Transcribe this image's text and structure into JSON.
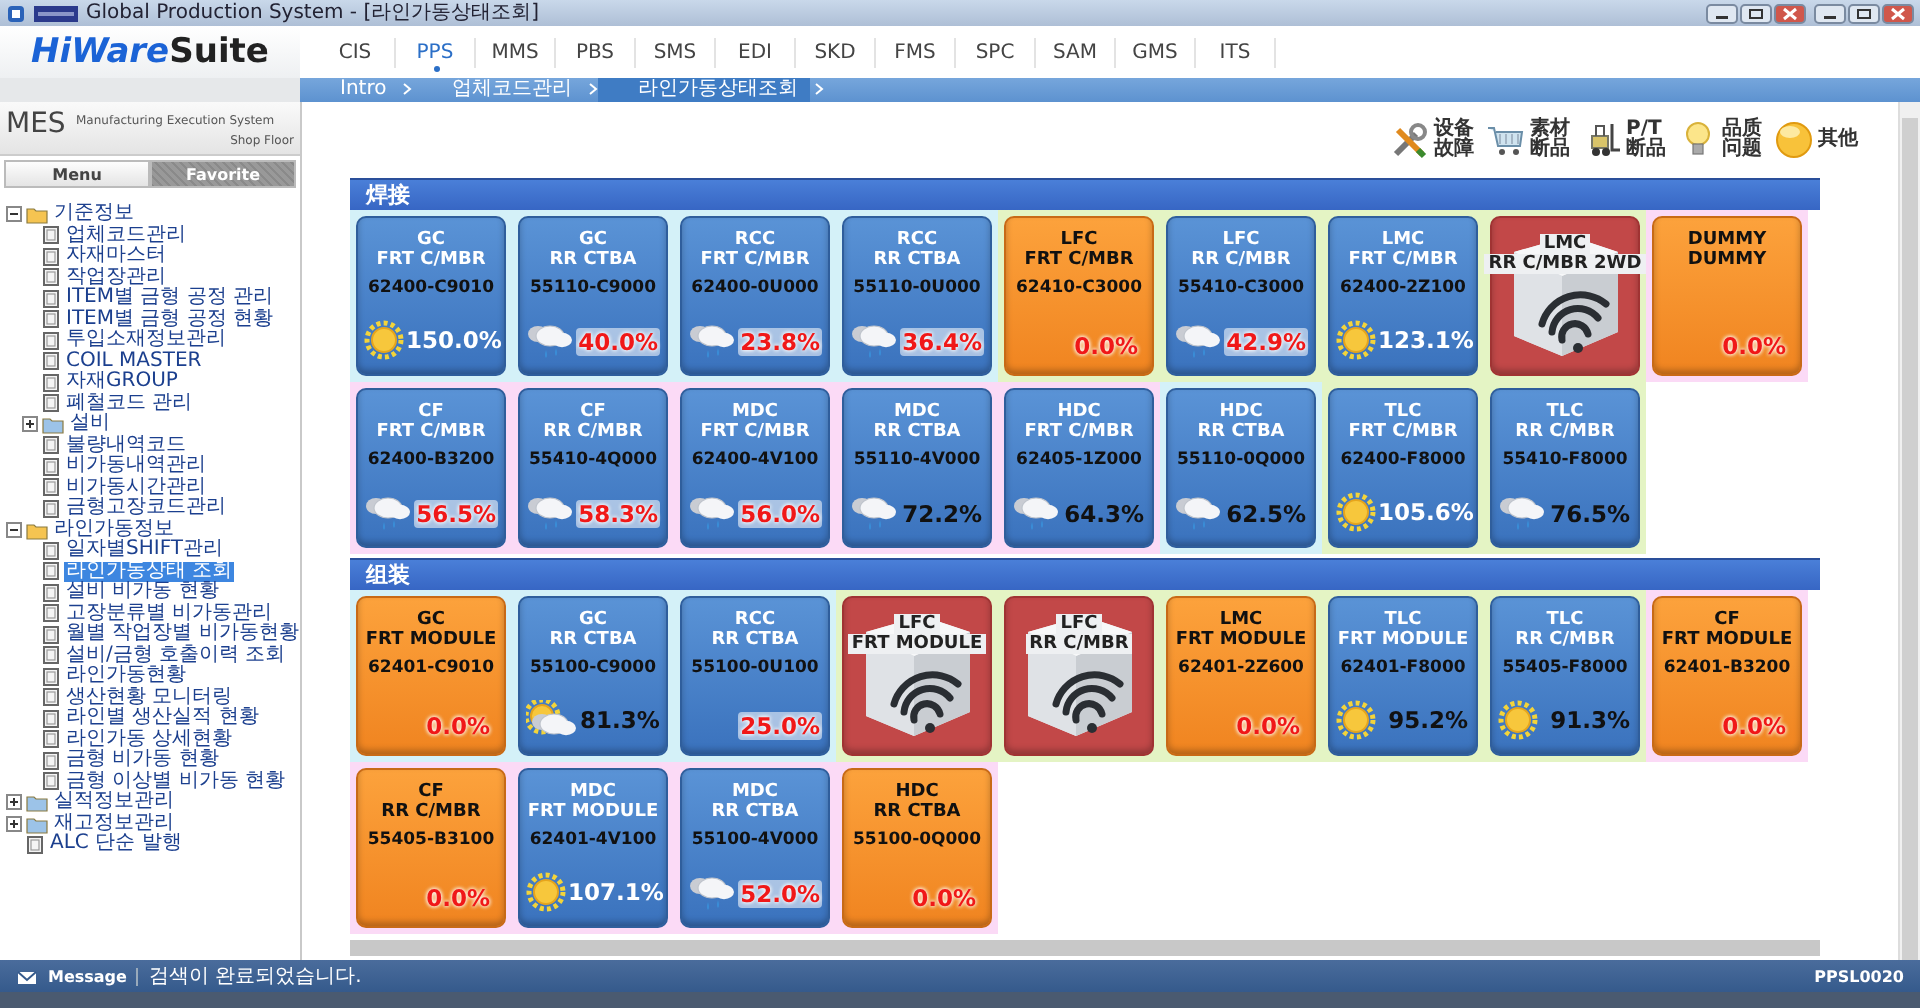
{
  "window": {
    "title": "Global Production System - [라인가동상태조회]"
  },
  "header": {
    "logo": {
      "first": "HiWare",
      "second": "Suite"
    },
    "nav": [
      {
        "label": "CIS",
        "selected": false
      },
      {
        "label": "PPS",
        "selected": true
      },
      {
        "label": "MMS",
        "selected": false
      },
      {
        "label": "PBS",
        "selected": false
      },
      {
        "label": "SMS",
        "selected": false
      },
      {
        "label": "EDI",
        "selected": false
      },
      {
        "label": "SKD",
        "selected": false
      },
      {
        "label": "FMS",
        "selected": false
      },
      {
        "label": "SPC",
        "selected": false
      },
      {
        "label": "SAM",
        "selected": false
      },
      {
        "label": "GMS",
        "selected": false
      },
      {
        "label": "ITS",
        "selected": false
      }
    ]
  },
  "breadcrumb": [
    "Intro",
    "업체코드관리",
    "라인가동상태조회"
  ],
  "sidebar": {
    "title": "MES",
    "subtitle": "Manufacturing Execution System",
    "caption": "Shop Floor",
    "tabs": [
      {
        "label": "Menu",
        "selected": true
      },
      {
        "label": "Favorite",
        "selected": false
      }
    ],
    "tree": [
      {
        "kind": "folder",
        "label": "기준정보",
        "expanded": true,
        "children": [
          {
            "kind": "page",
            "label": "업체코드관리",
            "selected": false
          },
          {
            "kind": "page",
            "label": "자재마스터",
            "selected": false
          },
          {
            "kind": "page",
            "label": "작업장관리",
            "selected": false
          },
          {
            "kind": "page",
            "label": "ITEM별 금형 공정 관리",
            "selected": false
          },
          {
            "kind": "page",
            "label": "ITEM별 금형 공정 현황",
            "selected": false
          },
          {
            "kind": "page",
            "label": "투입소재정보관리",
            "selected": false
          },
          {
            "kind": "page",
            "label": "COIL MASTER",
            "selected": false
          },
          {
            "kind": "page",
            "label": "자재GROUP",
            "selected": false
          },
          {
            "kind": "page",
            "label": "폐철코드 관리",
            "selected": false
          },
          {
            "kind": "folder",
            "label": "설비",
            "expanded": false
          },
          {
            "kind": "page",
            "label": "불량내역코드",
            "selected": false
          },
          {
            "kind": "page",
            "label": "비가동내역관리",
            "selected": false
          },
          {
            "kind": "page",
            "label": "비가동시간관리",
            "selected": false
          },
          {
            "kind": "page",
            "label": "금형고장코드관리",
            "selected": false
          }
        ]
      },
      {
        "kind": "folder",
        "label": "라인가동정보",
        "expanded": true,
        "children": [
          {
            "kind": "page",
            "label": "일자별SHIFT관리",
            "selected": false
          },
          {
            "kind": "page",
            "label": "라인가동상태 조회",
            "selected": true
          },
          {
            "kind": "page",
            "label": "설비 비가동 현황",
            "selected": false
          },
          {
            "kind": "page",
            "label": "고장분류별 비가동관리",
            "selected": false
          },
          {
            "kind": "page",
            "label": "월별 작업장별 비가동현황",
            "selected": false
          },
          {
            "kind": "page",
            "label": "설비/금형 호출이력 조회",
            "selected": false
          },
          {
            "kind": "page",
            "label": "라인가동현황",
            "selected": false
          },
          {
            "kind": "page",
            "label": "생산현황 모니터링",
            "selected": false
          },
          {
            "kind": "page",
            "label": "라인별 생산실적 현황",
            "selected": false
          },
          {
            "kind": "page",
            "label": "라인가동 상세현황",
            "selected": false
          },
          {
            "kind": "page",
            "label": "금형 비가동 현황",
            "selected": false
          },
          {
            "kind": "page",
            "label": "금형 이상별 비가동 현황",
            "selected": false
          }
        ]
      },
      {
        "kind": "folder",
        "label": "실적정보관리",
        "expanded": false
      },
      {
        "kind": "folder",
        "label": "재고정보관리",
        "expanded": false
      },
      {
        "kind": "page",
        "label": "ALC 단순 발행",
        "selected": false
      }
    ]
  },
  "legend": [
    {
      "kind": "tools",
      "label": "设备故障"
    },
    {
      "kind": "cart",
      "label": "素材断品"
    },
    {
      "kind": "forklift",
      "label": "P/T断品"
    },
    {
      "kind": "bulb",
      "label": "品质问题"
    },
    {
      "kind": "ball",
      "label": "其他"
    }
  ],
  "sections": [
    {
      "title": "焊接",
      "rows": [
        {
          "groups": [
            {
              "color": "#d4f1f8",
              "cards": [
                {
                  "kind": "running",
                  "line": "GC",
                  "part": "FRT C/MBR",
                  "code": "62400-C9010",
                  "weather": {
                    "kind": "sunny"
                  },
                  "rate": "150.0%",
                  "below_target": false,
                  "above_target": true
                },
                {
                  "kind": "running",
                  "line": "GC",
                  "part": "RR CTBA",
                  "code": "55110-C9000",
                  "weather": {
                    "kind": "rainy"
                  },
                  "rate": "40.0%",
                  "below_target": true,
                  "above_target": false
                },
                {
                  "kind": "running",
                  "line": "RCC",
                  "part": "FRT C/MBR",
                  "code": "62400-0U000",
                  "weather": {
                    "kind": "rainy"
                  },
                  "rate": "23.8%",
                  "below_target": true,
                  "above_target": false
                },
                {
                  "kind": "running",
                  "line": "RCC",
                  "part": "RR CTBA",
                  "code": "55110-0U000",
                  "weather": {
                    "kind": "rainy"
                  },
                  "rate": "36.4%",
                  "below_target": true,
                  "above_target": false
                }
              ]
            },
            {
              "color": "#e4f4c4",
              "cards": [
                {
                  "kind": "stopped",
                  "line": "LFC",
                  "part": "FRT C/MBR",
                  "code": "62410-C3000",
                  "rate": "0.0%"
                },
                {
                  "kind": "running",
                  "line": "LFC",
                  "part": "RR C/MBR",
                  "code": "55410-C3000",
                  "weather": {
                    "kind": "rainy"
                  },
                  "rate": "42.9%",
                  "below_target": true,
                  "above_target": false
                },
                {
                  "kind": "running",
                  "line": "LMC",
                  "part": "FRT C/MBR",
                  "code": "62400-2Z100",
                  "weather": {
                    "kind": "sunny"
                  },
                  "rate": "123.1%",
                  "below_target": false,
                  "above_target": true
                },
                {
                  "kind": "offline",
                  "line": "LMC",
                  "part": "RR C/MBR 2WD"
                }
              ]
            },
            {
              "color": "#fbdaf6",
              "cards": [
                {
                  "kind": "stopped",
                  "line": "DUMMY",
                  "part": "DUMMY",
                  "rate": "0.0%"
                }
              ]
            }
          ]
        },
        {
          "groups": [
            {
              "color": "#fbdaf6",
              "cards": [
                {
                  "kind": "running",
                  "line": "CF",
                  "part": "FRT C/MBR",
                  "code": "62400-B3200",
                  "weather": {
                    "kind": "rainy"
                  },
                  "rate": "56.5%",
                  "below_target": true,
                  "above_target": false
                },
                {
                  "kind": "running",
                  "line": "CF",
                  "part": "RR C/MBR",
                  "code": "55410-4Q000",
                  "weather": {
                    "kind": "rainy"
                  },
                  "rate": "58.3%",
                  "below_target": true,
                  "above_target": false
                },
                {
                  "kind": "running",
                  "line": "MDC",
                  "part": "FRT C/MBR",
                  "code": "62400-4V100",
                  "weather": {
                    "kind": "rainy"
                  },
                  "rate": "56.0%",
                  "below_target": true,
                  "above_target": false
                },
                {
                  "kind": "running",
                  "line": "MDC",
                  "part": "RR CTBA",
                  "code": "55110-4V000",
                  "weather": {
                    "kind": "rainy"
                  },
                  "rate": "72.2%",
                  "below_target": false,
                  "above_target": false
                },
                {
                  "kind": "running",
                  "line": "HDC",
                  "part": "FRT C/MBR",
                  "code": "62405-1Z000",
                  "weather": {
                    "kind": "rainy"
                  },
                  "rate": "64.3%",
                  "below_target": false,
                  "above_target": false
                }
              ]
            },
            {
              "color": "#d4f1f8",
              "cards": [
                {
                  "kind": "running",
                  "line": "HDC",
                  "part": "RR CTBA",
                  "code": "55110-0Q000",
                  "weather": {
                    "kind": "rainy"
                  },
                  "rate": "62.5%",
                  "below_target": false,
                  "above_target": false
                }
              ]
            },
            {
              "color": "#e4f4c4",
              "cards": [
                {
                  "kind": "running",
                  "line": "TLC",
                  "part": "FRT C/MBR",
                  "code": "62400-F8000",
                  "weather": {
                    "kind": "sunny"
                  },
                  "rate": "105.6%",
                  "below_target": false,
                  "above_target": true
                },
                {
                  "kind": "running",
                  "line": "TLC",
                  "part": "RR C/MBR",
                  "code": "55410-F8000",
                  "weather": {
                    "kind": "rainy"
                  },
                  "rate": "76.5%",
                  "below_target": false,
                  "above_target": false
                }
              ]
            }
          ]
        }
      ]
    },
    {
      "title": "组装",
      "rows": [
        {
          "groups": [
            {
              "color": "#d4f1f8",
              "cards": [
                {
                  "kind": "stopped",
                  "line": "GC",
                  "part": "FRT MODULE",
                  "code": "62401-C9010",
                  "rate": "0.0%"
                },
                {
                  "kind": "running",
                  "line": "GC",
                  "part": "RR CTBA",
                  "code": "55100-C9000",
                  "weather": {
                    "kind": "partly"
                  },
                  "rate": "81.3%",
                  "below_target": false,
                  "above_target": false
                },
                {
                  "kind": "running",
                  "line": "RCC",
                  "part": "RR CTBA",
                  "code": "55100-0U100",
                  "rate": "25.0%",
                  "below_target": true,
                  "above_target": false
                }
              ]
            },
            {
              "color": "#e4f4c4",
              "cards": [
                {
                  "kind": "offline",
                  "line": "LFC",
                  "part": "FRT MODULE"
                },
                {
                  "kind": "offline",
                  "line": "LFC",
                  "part": "RR C/MBR"
                },
                {
                  "kind": "stopped",
                  "line": "LMC",
                  "part": "FRT MODULE",
                  "code": "62401-2Z600",
                  "rate": "0.0%"
                },
                {
                  "kind": "running",
                  "line": "TLC",
                  "part": "FRT MODULE",
                  "code": "62401-F8000",
                  "weather": {
                    "kind": "sunny"
                  },
                  "rate": "95.2%",
                  "below_target": false,
                  "above_target": false
                },
                {
                  "kind": "running",
                  "line": "TLC",
                  "part": "RR C/MBR",
                  "code": "55405-F8000",
                  "weather": {
                    "kind": "sunny"
                  },
                  "rate": "91.3%",
                  "below_target": false,
                  "above_target": false
                }
              ]
            },
            {
              "color": "#fbdaf6",
              "cards": [
                {
                  "kind": "stopped",
                  "line": "CF",
                  "part": "FRT MODULE",
                  "code": "62401-B3200",
                  "rate": "0.0%"
                }
              ]
            }
          ]
        },
        {
          "groups": [
            {
              "color": "#fbdaf6",
              "cards": [
                {
                  "kind": "stopped",
                  "line": "CF",
                  "part": "RR C/MBR",
                  "code": "55405-B3100",
                  "rate": "0.0%"
                },
                {
                  "kind": "running",
                  "line": "MDC",
                  "part": "FRT MODULE",
                  "code": "62401-4V100",
                  "weather": {
                    "kind": "sunny"
                  },
                  "rate": "107.1%",
                  "below_target": false,
                  "above_target": true
                },
                {
                  "kind": "running",
                  "line": "MDC",
                  "part": "RR CTBA",
                  "code": "55100-4V000",
                  "weather": {
                    "kind": "rainy"
                  },
                  "rate": "52.0%",
                  "below_target": true,
                  "above_target": false
                },
                {
                  "kind": "stopped",
                  "line": "HDC",
                  "part": "RR CTBA",
                  "code": "55100-0Q000",
                  "rate": "0.0%"
                }
              ]
            }
          ]
        }
      ]
    }
  ],
  "status_bar": {
    "label": "Message",
    "message": "검색이 완료되었습니다.",
    "screen_id": "PPSL0020"
  }
}
